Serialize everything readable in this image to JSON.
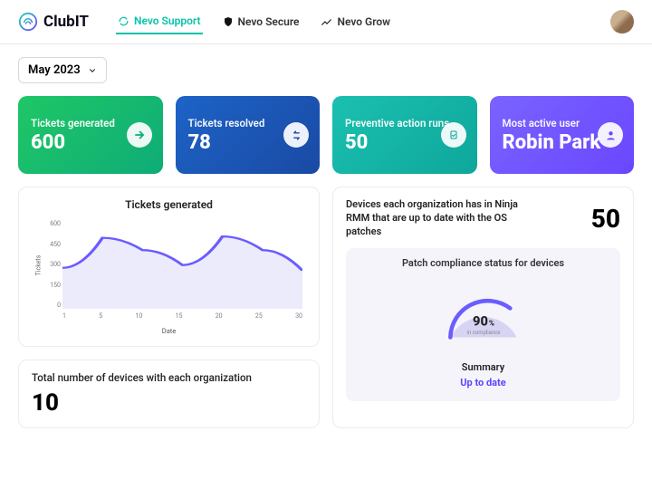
{
  "brand": "ClubIT",
  "tabs": [
    {
      "label": "Nevo Support",
      "active": true
    },
    {
      "label": "Nevo Secure",
      "active": false
    },
    {
      "label": "Nevo Grow",
      "active": false
    }
  ],
  "month_filter": "May 2023",
  "kpis": [
    {
      "title": "Tickets generated",
      "value": "600",
      "icon": "arrow"
    },
    {
      "title": "Tickets resolved",
      "value": "78",
      "icon": "swap"
    },
    {
      "title": "Preventive action runs",
      "value": "50",
      "icon": "clip"
    },
    {
      "title": "Most active user",
      "value": "Robin Park",
      "icon": "user"
    }
  ],
  "chart_data": {
    "type": "line",
    "title": "Tickets generated",
    "xlabel": "Date",
    "ylabel": "Tickets",
    "categories": [
      1,
      5,
      10,
      15,
      20,
      25,
      30
    ],
    "y_ticks": [
      0,
      150,
      300,
      450,
      600
    ],
    "ylim": [
      0,
      650
    ],
    "values": [
      300,
      520,
      430,
      320,
      530,
      430,
      280
    ]
  },
  "right": {
    "devices_uptodate_label": "Devices each organization has in Ninja RMM that are up to date with the OS patches",
    "devices_uptodate_value": "50",
    "patch_title": "Patch compliance status for devices",
    "patch_pct": "90",
    "patch_pct_unit": "%",
    "patch_sub": "in compliance",
    "summary_header": "Summary",
    "summary_link": "Up to date"
  },
  "devices_panel": {
    "label": "Total number of devices with each organization",
    "value": "10"
  }
}
